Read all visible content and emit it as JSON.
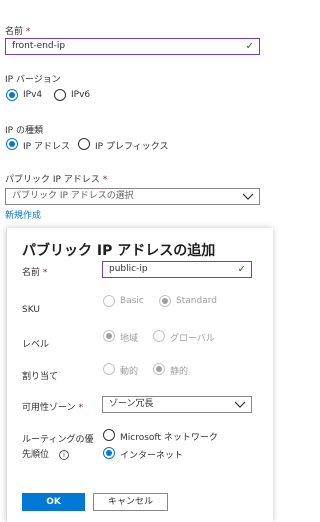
{
  "colors": {
    "accent": "#0078d4",
    "focus": "#6f3cc3",
    "valid": "#107c10",
    "required": "#a4262c"
  },
  "form": {
    "name_label": "名前",
    "required_mark": "*",
    "name_value": "front-end-ip",
    "ip_version_label": "IP バージョン",
    "ip_version_options": [
      "IPv4",
      "IPv6"
    ],
    "ip_version_selected": "IPv4",
    "ip_type_label": "IP の種類",
    "ip_type_options": [
      "IP アドレス",
      "IP プレフィックス"
    ],
    "ip_type_selected": "IP アドレス",
    "public_ip_label": "パブリック IP アドレス",
    "public_ip_placeholder": "パブリック IP アドレスの選択",
    "create_new_link": "新規作成"
  },
  "panel": {
    "title": "パブリック IP アドレスの追加",
    "name_label": "名前",
    "name_value": "public-ip",
    "sku_label": "SKU",
    "sku_options": [
      "Basic",
      "Standard"
    ],
    "sku_selected": "Standard",
    "level_label": "レベル",
    "level_options": [
      "地域",
      "グローバル"
    ],
    "level_selected": "地域",
    "assignment_label": "割り当て",
    "assignment_options": [
      "動的",
      "静的"
    ],
    "assignment_selected": "静的",
    "zone_label": "可用性ゾーン",
    "zone_value": "ゾーン冗長",
    "routing_label_line1": "ルーティングの優",
    "routing_label_line2": "先順位",
    "routing_options": [
      "Microsoft ネットワーク",
      "インターネット"
    ],
    "routing_selected": "インターネット",
    "info_icon": "i",
    "ok_button": "OK",
    "cancel_button": "キャンセル"
  }
}
